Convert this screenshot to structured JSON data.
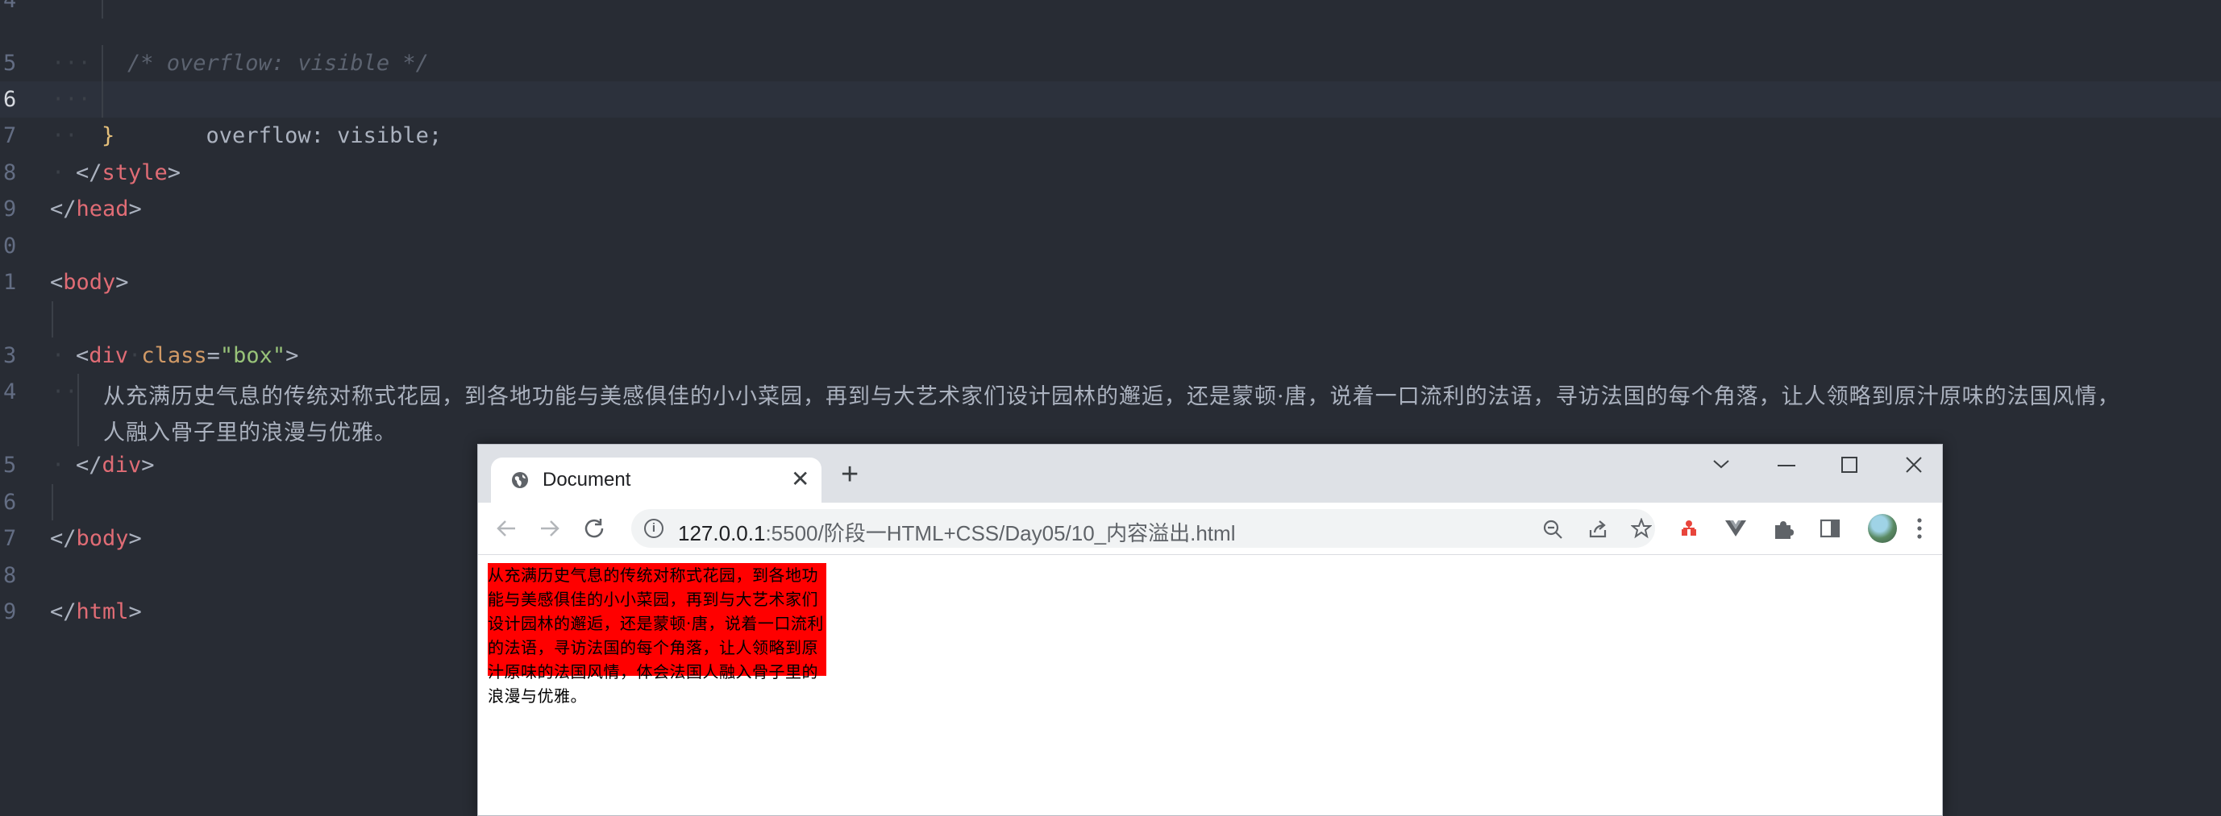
{
  "editor": {
    "line_numbers": [
      "4",
      "5",
      "6",
      "7",
      "8",
      "9",
      "0",
      "1",
      "",
      "3",
      "4",
      "",
      "5",
      "6",
      "7",
      "8",
      "9"
    ],
    "comment": "/* overflow: visible */",
    "property": "overflow",
    "colon": ":",
    "value": "visible",
    "semicolon": ";",
    "close_brace": "}",
    "style_close": "style",
    "head_close": "head",
    "body_tag": "body",
    "div_tag": "div",
    "class_attr": "class",
    "class_value": "\"box\"",
    "text_line1": "从充满历史气息的传统对称式花园，到各地功能与美感俱佳的小小菜园，再到与大艺术家们设计园林的邂逅，还是蒙顿·唐，说着一口流利的法语，寻访法国的每个角落，让人领略到原汁原味的法国风情，",
    "text_line2": "人融入骨子里的浪漫与优雅。",
    "html_tag": "html"
  },
  "browser": {
    "tab_title": "Document",
    "tab_close": "✕",
    "new_tab": "+",
    "url_host": "127.0.0.1",
    "url_rest": ":5500/阶段一HTML+CSS/Day05/10_内容溢出.html",
    "box_text": "从充满历史气息的传统对称式花园，到各地功能与美感俱佳的小小菜园，再到与大艺术家们设计园林的邂逅，还是蒙顿·唐，说着一口流利的法语，寻访法国的每个角落，让人领略到原汁原味的法国风情，体会法国人融入骨子里的浪漫与优雅。"
  },
  "colors": {
    "editor_bg": "#282c34",
    "tag": "#e06c75",
    "attr": "#d19a66",
    "string": "#98c379",
    "brace": "#e5c07b",
    "box_bg": "#ff0000"
  },
  "icons": [
    "globe-icon",
    "close-icon",
    "plus-icon",
    "chevron-down-icon",
    "minimize-icon",
    "maximize-icon",
    "window-close-icon",
    "back-icon",
    "forward-icon",
    "reload-icon",
    "info-icon",
    "zoom-out-icon",
    "share-icon",
    "star-icon",
    "extension-red-icon",
    "vue-devtools-icon",
    "puzzle-icon",
    "sidepanel-icon",
    "avatar",
    "kebab-menu-icon"
  ]
}
